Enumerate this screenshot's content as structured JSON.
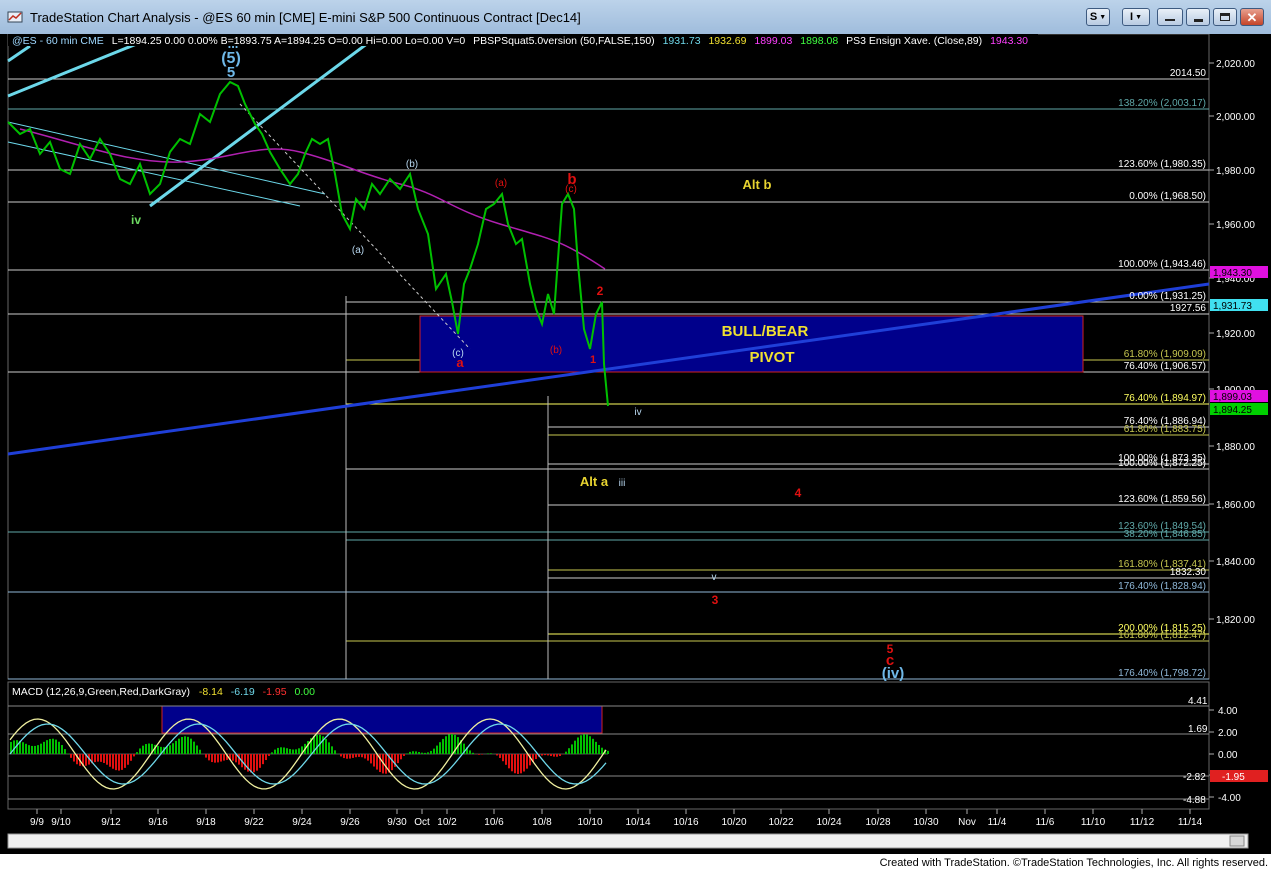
{
  "window": {
    "title": "TradeStation Chart Analysis - @ES 60 min [CME] E-mini S&P 500 Continuous Contract [Dec14]",
    "buttons": {
      "s": "S",
      "i": "I"
    }
  },
  "status": {
    "symbol": "@ES - 60 min  CME",
    "ohlc": "L=1894.25  0.00  0.00%  B=1893.75  A=1894.25  O=0.00  Hi=0.00  Lo=0.00  V=0",
    "study1_name": "PBSPSquat5.0version (50,FALSE,150)",
    "study1_values": [
      "1931.73",
      "1932.69",
      "1899.03",
      "1898.08"
    ],
    "study2_name": "PS3 Ensign Xave. (Close,89)",
    "study2_value": "1943.30"
  },
  "macd_header": {
    "name": "MACD (12,26,9,Green,Red,DarkGray)",
    "values": [
      "-8.14",
      "-6.19",
      "-1.95",
      "0.00"
    ]
  },
  "colors": {
    "price": "#00c000",
    "bull_bear_box": "#00008b",
    "trend_line": "#1f3fd8",
    "channel": "#6cd8ea",
    "wave_red": "#e01010",
    "wave_blue": "#6fb8e8",
    "alt_yellow": "#e8d430"
  },
  "price_axis": {
    "ticks": [
      "2,020.00",
      "2,000.00",
      "1,980.00",
      "1,960.00",
      "1,940.00",
      "1,920.00",
      "1,900.00",
      "1,880.00",
      "1,860.00",
      "1,840.00",
      "1,820.00"
    ],
    "price_tag": "1,894.25",
    "tag_1943": "1,943.30",
    "tag_1931": "1,931.73",
    "tag_1899": "1,899.03"
  },
  "macd_axis": {
    "ticks": [
      "4.00",
      "2.00",
      "0.00",
      "-2.00",
      "-4.00"
    ],
    "level_441": "4.41",
    "level_169": "1.69",
    "level_282": "-2.82",
    "level_488": "-4.88",
    "macd_tag": "-1.95"
  },
  "time_axis": [
    "9/9",
    "9/10",
    "9/12",
    "9/16",
    "9/18",
    "9/22",
    "9/24",
    "9/26",
    "9/30",
    "Oct",
    "10/2",
    "10/6",
    "10/8",
    "10/10",
    "10/14",
    "10/16",
    "10/20",
    "10/22",
    "10/24",
    "10/28",
    "10/30",
    "Nov",
    "11/4",
    "11/6",
    "11/10",
    "11/12",
    "11/14"
  ],
  "fib_labels": [
    {
      "text": "2014.50",
      "color": "#ffffff"
    },
    {
      "text": "138.20% (2,003.17)",
      "color": "#5fa8a8"
    },
    {
      "text": "123.60% (1,980.35)",
      "color": "#ffffff"
    },
    {
      "text": "0.00% (1,968.50)",
      "color": "#ffffff"
    },
    {
      "text": "100.00% (1,943.46)",
      "color": "#ffffff"
    },
    {
      "text": "0.00% (1,931.25)",
      "color": "#ffffff"
    },
    {
      "text": "1927.56",
      "color": "#ffffff"
    },
    {
      "text": "61.80% (1,909.09)",
      "color": "#c8c850"
    },
    {
      "text": "76.40% (1,906.57)",
      "color": "#ffffff"
    },
    {
      "text": "76.40% (1,894.97)",
      "color": "#ffff60"
    },
    {
      "text": "76.40% (1,886.94)",
      "color": "#ffffff"
    },
    {
      "text": "61.80% (1,883.75)",
      "color": "#c8c850"
    },
    {
      "text": "100.00% (1,873.35)",
      "color": "#ffffff"
    },
    {
      "text": "100.00% (1,872.25)",
      "color": "#ffffff"
    },
    {
      "text": "123.60% (1,859.56)",
      "color": "#ffffff"
    },
    {
      "text": "123.60% (1,849.54)",
      "color": "#5fa8a8"
    },
    {
      "text": "38.20% (1,846.85)",
      "color": "#5fa8a8"
    },
    {
      "text": "161.80% (1,837.41)",
      "color": "#c8c850"
    },
    {
      "text": "1832.30",
      "color": "#ffffff"
    },
    {
      "text": "176.40% (1,828.94)",
      "color": "#8fb8d8"
    },
    {
      "text": "200.00% (1,815.25)",
      "color": "#ffff60"
    },
    {
      "text": "161.80% (1,812.47)",
      "color": "#c8c850"
    },
    {
      "text": "176.40% (1,798.72)",
      "color": "#8fb8d8"
    }
  ],
  "annotations": {
    "wave_iii": "iii",
    "wave_5": "5",
    "wave_5_paren": "(5)",
    "wave_iv": "iv",
    "wave_b_paren": "(b)",
    "wave_a_paren": "(a)",
    "wave_c_paren": "(c)",
    "wave_a_red": "a",
    "wave_a_red_paren": "(a)",
    "wave_b_red": "b",
    "wave_c_red_paren": "(c)",
    "wave_b_low_paren": "(b)",
    "wave_2": "2",
    "wave_1": "1",
    "wave_iv_small": "iv",
    "wave_iii_small": "iii",
    "wave_v_small": "v",
    "wave_3": "3",
    "wave_4": "4",
    "wave_5_red": "5",
    "wave_c_red": "c",
    "wave_iv_paren": "(iv)",
    "alt_b": "Alt b",
    "alt_a": "Alt a",
    "bull_bear_1": "BULL/BEAR",
    "bull_bear_2": "PIVOT"
  },
  "footer": "Created with TradeStation. ©TradeStation Technologies, Inc. All rights reserved."
}
